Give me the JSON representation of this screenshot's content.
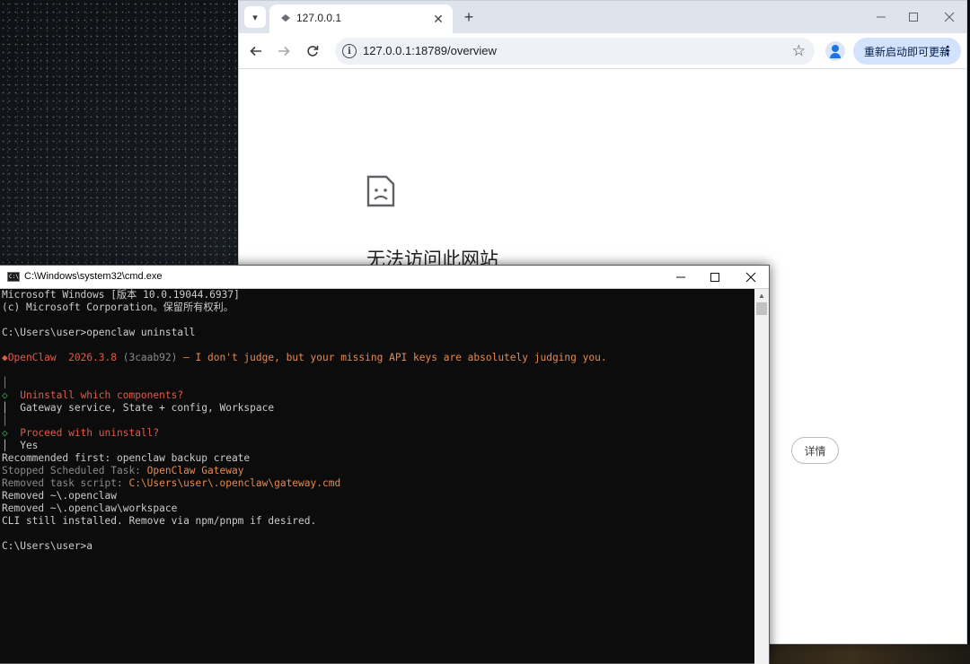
{
  "browser": {
    "tab_title": "127.0.0.1",
    "tab_close": "✕",
    "new_tab": "+",
    "url": "127.0.0.1:18789/overview",
    "update_button": "重新启动即可更新",
    "error_title": "无法访问此网站",
    "details_button": "详情"
  },
  "cmd": {
    "title": "C:\\Windows\\system32\\cmd.exe",
    "lines": [
      {
        "segments": [
          {
            "text": "Microsoft Windows [版本 10.0.19044.6937]",
            "cls": ""
          }
        ]
      },
      {
        "segments": [
          {
            "text": "(c) Microsoft Corporation。保留所有权利。",
            "cls": ""
          }
        ]
      },
      {
        "segments": [
          {
            "text": "",
            "cls": ""
          }
        ]
      },
      {
        "segments": [
          {
            "text": "C:\\Users\\user>openclaw uninstall",
            "cls": ""
          }
        ]
      },
      {
        "segments": [
          {
            "text": "",
            "cls": ""
          }
        ]
      },
      {
        "segments": [
          {
            "text": "◆OpenClaw  2026.3.8 ",
            "cls": "red"
          },
          {
            "text": "(3caab92)",
            "cls": "dim"
          },
          {
            "text": " — I don't judge, but your missing API keys are absolutely judging you.",
            "cls": "orange"
          }
        ]
      },
      {
        "segments": [
          {
            "text": "",
            "cls": ""
          }
        ]
      },
      {
        "segments": [
          {
            "text": "│",
            "cls": "dim"
          }
        ]
      },
      {
        "segments": [
          {
            "text": "◇",
            "cls": "green"
          },
          {
            "text": "  Uninstall which components?",
            "cls": "red"
          }
        ]
      },
      {
        "segments": [
          {
            "text": "│  Gateway service, State + config, Workspace",
            "cls": ""
          }
        ]
      },
      {
        "segments": [
          {
            "text": "│",
            "cls": "dim"
          }
        ]
      },
      {
        "segments": [
          {
            "text": "◇",
            "cls": "green"
          },
          {
            "text": "  Proceed with uninstall?",
            "cls": "red"
          }
        ]
      },
      {
        "segments": [
          {
            "text": "│  Yes",
            "cls": ""
          }
        ]
      },
      {
        "segments": [
          {
            "text": "Recommended first: openclaw backup create",
            "cls": ""
          }
        ]
      },
      {
        "segments": [
          {
            "text": "Stopped Scheduled Task: ",
            "cls": "dim"
          },
          {
            "text": "OpenClaw Gateway",
            "cls": "orange"
          }
        ]
      },
      {
        "segments": [
          {
            "text": "Removed task script: ",
            "cls": "dim"
          },
          {
            "text": "C:\\Users\\user\\.openclaw\\gateway.cmd",
            "cls": "orange"
          }
        ]
      },
      {
        "segments": [
          {
            "text": "Removed ~\\.openclaw",
            "cls": ""
          }
        ]
      },
      {
        "segments": [
          {
            "text": "Removed ~\\.openclaw\\workspace",
            "cls": ""
          }
        ]
      },
      {
        "segments": [
          {
            "text": "CLI still installed. Remove via npm/pnpm if desired.",
            "cls": ""
          }
        ]
      },
      {
        "segments": [
          {
            "text": "",
            "cls": ""
          }
        ]
      },
      {
        "segments": [
          {
            "text": "C:\\Users\\user>a",
            "cls": ""
          }
        ]
      }
    ]
  }
}
